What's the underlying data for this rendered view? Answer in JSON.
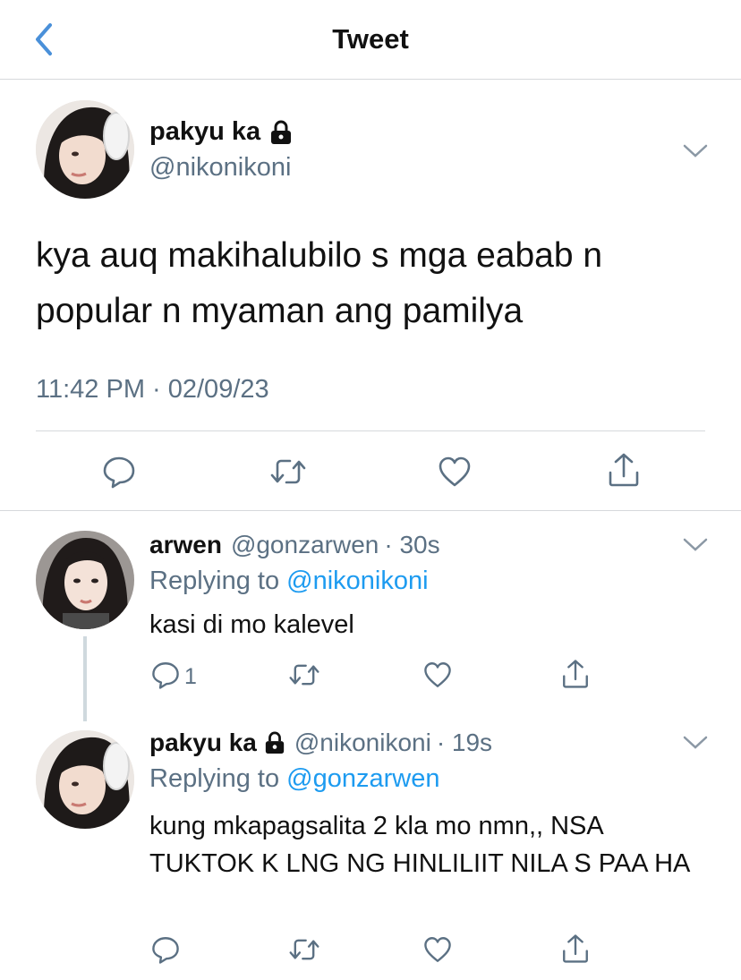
{
  "header": {
    "title": "Tweet"
  },
  "main_tweet": {
    "display_name": "pakyu ka",
    "handle": "@nikonikoni",
    "text": "kya auq makihalubilo s mga eabab n popular n myaman ang pamilya",
    "timestamp": "11:42 PM · 02/09/23"
  },
  "replies": [
    {
      "display_name": "arwen",
      "handle": "@gonzarwen",
      "time": "· 30s",
      "replying_prefix": "Replying to",
      "replying_to": "@nikonikoni",
      "text": "kasi di mo kalevel",
      "reply_count": "1"
    },
    {
      "display_name": "pakyu ka",
      "handle": "@nikonikoni",
      "time": "· 19s",
      "replying_prefix": "Replying to",
      "replying_to": "@gonzarwen",
      "text": "kung mkapagsalita 2 kla mo nmn,, NSA TUKTOK K LNG NG HINLILIIT NILA S PAA HA",
      "reply_count": ""
    }
  ],
  "colors": {
    "accent": "#1d9bf0",
    "secondary_text": "#5b7083",
    "divider": "#d6d9dc",
    "back_arrow": "#4a90d9"
  },
  "icons": [
    "back-arrow-icon",
    "lock-icon",
    "chevron-down-icon",
    "reply-icon",
    "retweet-icon",
    "like-icon",
    "share-icon"
  ]
}
